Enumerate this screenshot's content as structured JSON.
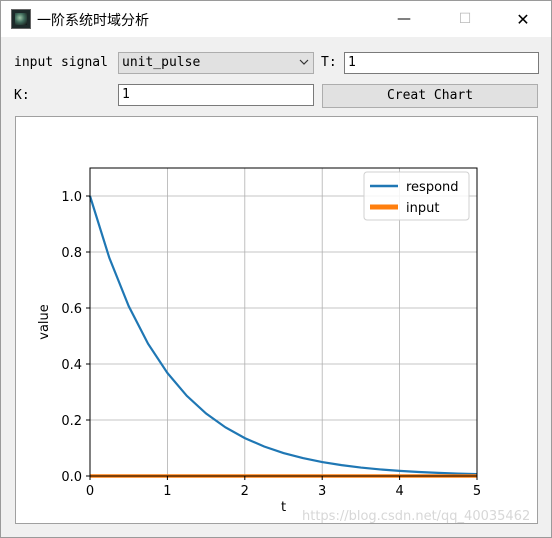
{
  "window": {
    "title": "一阶系统时域分析",
    "minimize": "—",
    "maximize": "☐",
    "close": "✕"
  },
  "controls": {
    "input_signal_label": "input signal",
    "input_signal_value": "unit_pulse",
    "T_label": "T:",
    "T_value": "1",
    "K_label": "K:",
    "K_value": "1",
    "create_button": "Creat Chart"
  },
  "chart_data": {
    "type": "line",
    "xlabel": "t",
    "ylabel": "value",
    "xlim": [
      0,
      5
    ],
    "ylim": [
      0,
      1.1
    ],
    "xticks": [
      "0",
      "1",
      "2",
      "3",
      "4",
      "5"
    ],
    "yticks": [
      "0.0",
      "0.2",
      "0.4",
      "0.6",
      "0.8",
      "1.0"
    ],
    "grid": true,
    "legend_position": "top-right",
    "series": [
      {
        "name": "respond",
        "color": "#1f77b4",
        "x": [
          0,
          0.25,
          0.5,
          0.75,
          1,
          1.25,
          1.5,
          1.75,
          2,
          2.25,
          2.5,
          2.75,
          3,
          3.25,
          3.5,
          3.75,
          4,
          4.25,
          4.5,
          4.75,
          5
        ],
        "y": [
          1,
          0.7788,
          0.6065,
          0.4724,
          0.3679,
          0.2865,
          0.2231,
          0.1738,
          0.1353,
          0.1054,
          0.0821,
          0.0639,
          0.0498,
          0.0388,
          0.0302,
          0.0235,
          0.0183,
          0.0143,
          0.0111,
          0.0087,
          0.0067
        ]
      },
      {
        "name": "input",
        "color": "#ff7f0e",
        "x": [
          0,
          5
        ],
        "y": [
          0,
          0
        ]
      }
    ]
  },
  "watermark": "https://blog.csdn.net/qq_40035462"
}
